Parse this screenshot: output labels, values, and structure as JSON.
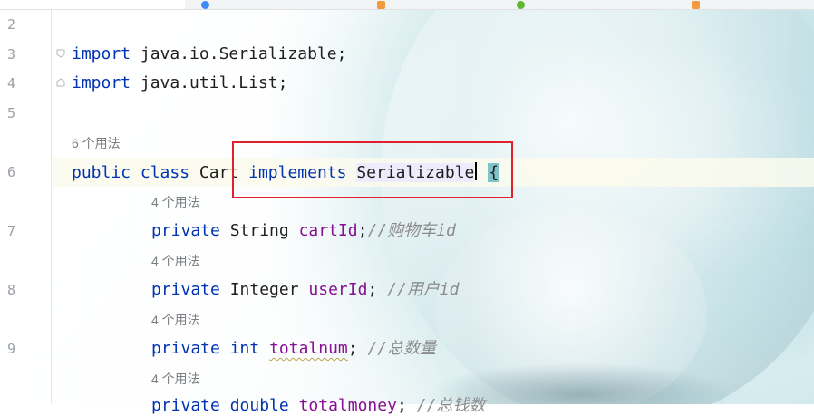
{
  "editor": {
    "line_numbers": [
      "2",
      "3",
      "4",
      "5",
      "6",
      "7",
      "8",
      "9"
    ],
    "usage_hints": {
      "class": "6 个用法",
      "field1": "4 个用法",
      "field2": "4 个用法",
      "field3": "4 个用法",
      "field4": "4 个用法"
    },
    "lines": {
      "l3": {
        "kw": "import",
        "rest": " java.io.Serializable;"
      },
      "l4": {
        "kw": "import",
        "rest": " java.util.List;"
      },
      "l6": {
        "kw1": "public",
        "kw2": "class",
        "name": "Cart",
        "kw3": "implements",
        "iface": "Serializable",
        "brace": "{"
      },
      "l7": {
        "kw": "private",
        "type": "String",
        "field": "cartId",
        "semi": ";",
        "comment": "//购物车id"
      },
      "l8": {
        "kw": "private",
        "type": "Integer",
        "field": "userId",
        "semi": ";",
        "comment": "//用户id"
      },
      "l9": {
        "kw": "private",
        "type": "int",
        "field": "totalnum",
        "semi": ";",
        "comment": "//总数量"
      },
      "l10": {
        "kw": "private",
        "type": "double",
        "field": "totalmoney",
        "semi": ";",
        "comment": "//总钱数"
      }
    },
    "colors": {
      "keyword": "#0033b3",
      "field": "#871094",
      "comment": "#8c8c8c",
      "highlight_box": "#e0202a"
    }
  }
}
